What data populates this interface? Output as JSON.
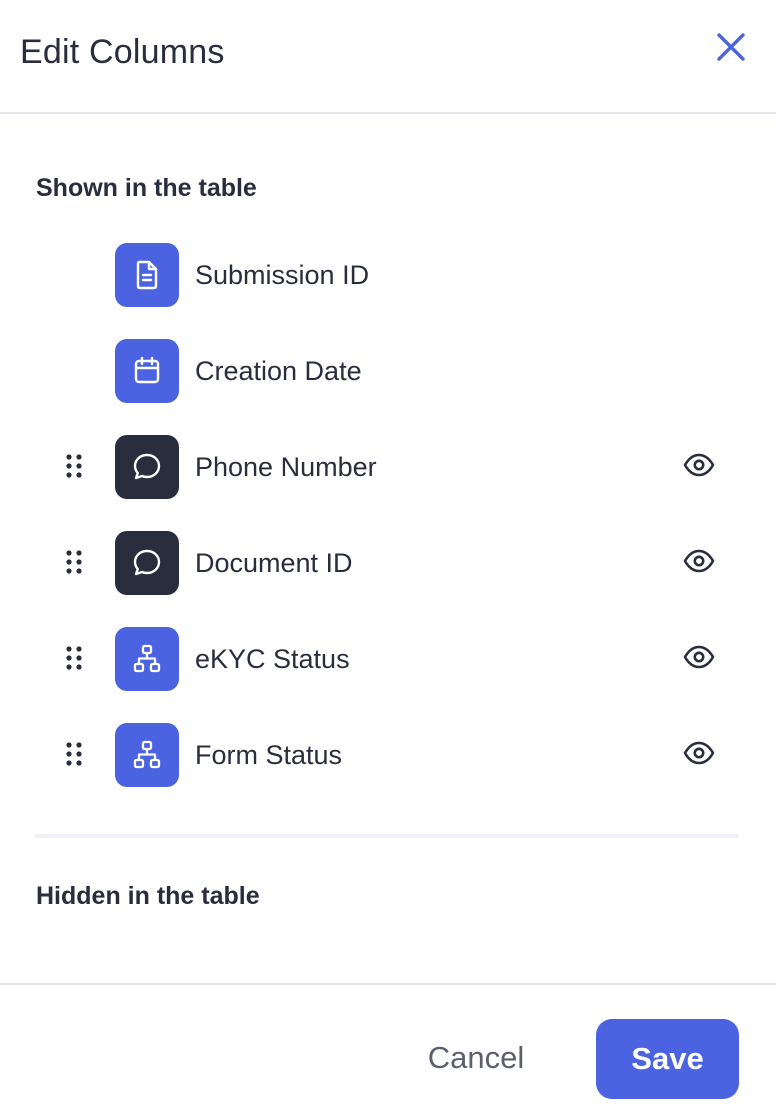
{
  "dialog": {
    "title": "Edit Columns",
    "close_icon": "close-icon"
  },
  "shown_section": {
    "title": "Shown in the table",
    "items": [
      {
        "label": "Submission ID",
        "icon": "document-icon",
        "icon_bg": "#4b63e0",
        "draggable": false,
        "has_visibility_toggle": false
      },
      {
        "label": "Creation Date",
        "icon": "calendar-icon",
        "icon_bg": "#4b63e0",
        "draggable": false,
        "has_visibility_toggle": false
      },
      {
        "label": "Phone Number",
        "icon": "chat-bubble-icon",
        "icon_bg": "#2a2d3e",
        "draggable": true,
        "has_visibility_toggle": true
      },
      {
        "label": "Document ID",
        "icon": "chat-bubble-icon",
        "icon_bg": "#2a2d3e",
        "draggable": true,
        "has_visibility_toggle": true
      },
      {
        "label": "eKYC Status",
        "icon": "hierarchy-icon",
        "icon_bg": "#4b63e0",
        "draggable": true,
        "has_visibility_toggle": true
      },
      {
        "label": "Form Status",
        "icon": "hierarchy-icon",
        "icon_bg": "#4b63e0",
        "draggable": true,
        "has_visibility_toggle": true
      }
    ]
  },
  "hidden_section": {
    "title": "Hidden in the table",
    "items": []
  },
  "footer": {
    "cancel_label": "Cancel",
    "save_label": "Save"
  },
  "colors": {
    "accent": "#4b63e0",
    "dark": "#2a2d3e",
    "text": "#2a2d3e",
    "muted": "#5c5f6e"
  }
}
